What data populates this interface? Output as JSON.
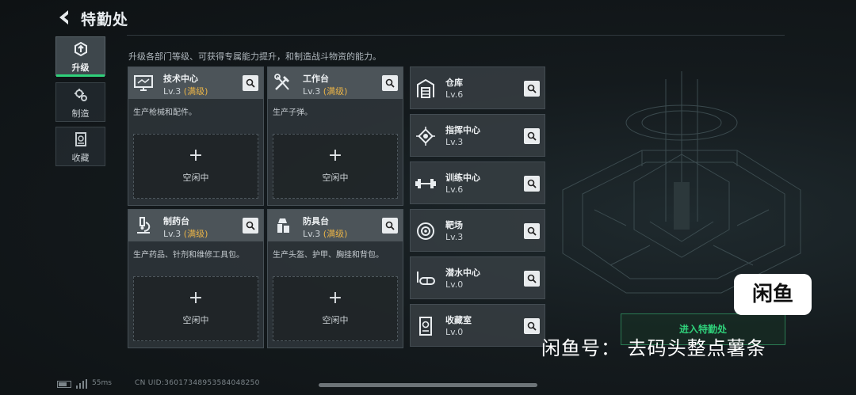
{
  "header": {
    "title": "特勤处"
  },
  "subtitle": "升级各部门等级、可获得专属能力提升，和制造战斗物资的能力。",
  "side_tabs": [
    {
      "label": "升级",
      "icon": "upgrade-icon",
      "active": true
    },
    {
      "label": "制造",
      "icon": "gears-icon",
      "active": false
    },
    {
      "label": "收藏",
      "icon": "collection-icon",
      "active": false
    }
  ],
  "cards": [
    {
      "name": "技术中心",
      "level": "Lv.3",
      "max": "(满级)",
      "desc": "生产枪械和配件。",
      "icon": "computer-icon",
      "slot_plus": "+",
      "slot_label": "空闲中"
    },
    {
      "name": "工作台",
      "level": "Lv.3",
      "max": "(满级)",
      "desc": "生产子弹。",
      "icon": "tools-icon",
      "slot_plus": "+",
      "slot_label": "空闲中"
    },
    {
      "name": "制药台",
      "level": "Lv.3",
      "max": "(满级)",
      "desc": "生产药品、针剂和维修工具包。",
      "icon": "microscope-icon",
      "slot_plus": "+",
      "slot_label": "空闲中"
    },
    {
      "name": "防具台",
      "level": "Lv.3",
      "max": "(满级)",
      "desc": "生产头盔、护甲、胸挂和背包。",
      "icon": "armor-icon",
      "slot_plus": "+",
      "slot_label": "空闲中"
    }
  ],
  "facilities": [
    {
      "name": "仓库",
      "level": "Lv.6",
      "icon": "warehouse-icon"
    },
    {
      "name": "指挥中心",
      "level": "Lv.3",
      "icon": "chip-icon"
    },
    {
      "name": "训练中心",
      "level": "Lv.6",
      "icon": "dumbbell-icon"
    },
    {
      "name": "靶场",
      "level": "Lv.3",
      "icon": "target-icon"
    },
    {
      "name": "潜水中心",
      "level": "Lv.0",
      "icon": "diving-mask-icon"
    },
    {
      "name": "收藏室",
      "level": "Lv.0",
      "icon": "collection-room-icon"
    }
  ],
  "enter_button": "进入特勤处",
  "watermark": {
    "logo": "闲鱼",
    "text": "闲鱼号：  去码头整点薯条"
  },
  "footer": {
    "ping": "55ms",
    "uid": "CN UID:36017348953584048250"
  },
  "colors": {
    "accent_green": "#2fd07a",
    "max_level": "#e9b347",
    "card_header": "#585f64"
  }
}
